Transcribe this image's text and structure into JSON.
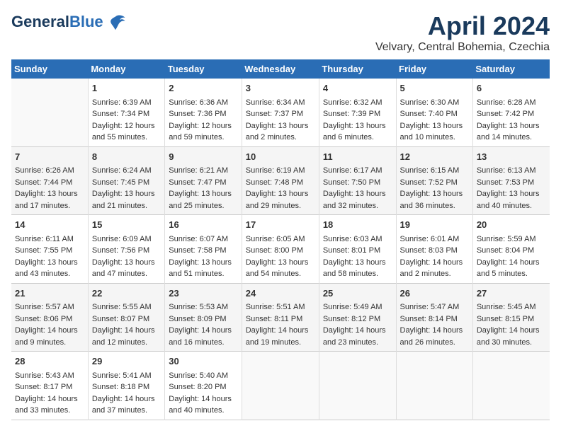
{
  "header": {
    "logo_line1": "General",
    "logo_line2": "Blue",
    "month": "April 2024",
    "location": "Velvary, Central Bohemia, Czechia"
  },
  "weekdays": [
    "Sunday",
    "Monday",
    "Tuesday",
    "Wednesday",
    "Thursday",
    "Friday",
    "Saturday"
  ],
  "weeks": [
    [
      {
        "day": "",
        "info": ""
      },
      {
        "day": "1",
        "info": "Sunrise: 6:39 AM\nSunset: 7:34 PM\nDaylight: 12 hours\nand 55 minutes."
      },
      {
        "day": "2",
        "info": "Sunrise: 6:36 AM\nSunset: 7:36 PM\nDaylight: 12 hours\nand 59 minutes."
      },
      {
        "day": "3",
        "info": "Sunrise: 6:34 AM\nSunset: 7:37 PM\nDaylight: 13 hours\nand 2 minutes."
      },
      {
        "day": "4",
        "info": "Sunrise: 6:32 AM\nSunset: 7:39 PM\nDaylight: 13 hours\nand 6 minutes."
      },
      {
        "day": "5",
        "info": "Sunrise: 6:30 AM\nSunset: 7:40 PM\nDaylight: 13 hours\nand 10 minutes."
      },
      {
        "day": "6",
        "info": "Sunrise: 6:28 AM\nSunset: 7:42 PM\nDaylight: 13 hours\nand 14 minutes."
      }
    ],
    [
      {
        "day": "7",
        "info": "Sunrise: 6:26 AM\nSunset: 7:44 PM\nDaylight: 13 hours\nand 17 minutes."
      },
      {
        "day": "8",
        "info": "Sunrise: 6:24 AM\nSunset: 7:45 PM\nDaylight: 13 hours\nand 21 minutes."
      },
      {
        "day": "9",
        "info": "Sunrise: 6:21 AM\nSunset: 7:47 PM\nDaylight: 13 hours\nand 25 minutes."
      },
      {
        "day": "10",
        "info": "Sunrise: 6:19 AM\nSunset: 7:48 PM\nDaylight: 13 hours\nand 29 minutes."
      },
      {
        "day": "11",
        "info": "Sunrise: 6:17 AM\nSunset: 7:50 PM\nDaylight: 13 hours\nand 32 minutes."
      },
      {
        "day": "12",
        "info": "Sunrise: 6:15 AM\nSunset: 7:52 PM\nDaylight: 13 hours\nand 36 minutes."
      },
      {
        "day": "13",
        "info": "Sunrise: 6:13 AM\nSunset: 7:53 PM\nDaylight: 13 hours\nand 40 minutes."
      }
    ],
    [
      {
        "day": "14",
        "info": "Sunrise: 6:11 AM\nSunset: 7:55 PM\nDaylight: 13 hours\nand 43 minutes."
      },
      {
        "day": "15",
        "info": "Sunrise: 6:09 AM\nSunset: 7:56 PM\nDaylight: 13 hours\nand 47 minutes."
      },
      {
        "day": "16",
        "info": "Sunrise: 6:07 AM\nSunset: 7:58 PM\nDaylight: 13 hours\nand 51 minutes."
      },
      {
        "day": "17",
        "info": "Sunrise: 6:05 AM\nSunset: 8:00 PM\nDaylight: 13 hours\nand 54 minutes."
      },
      {
        "day": "18",
        "info": "Sunrise: 6:03 AM\nSunset: 8:01 PM\nDaylight: 13 hours\nand 58 minutes."
      },
      {
        "day": "19",
        "info": "Sunrise: 6:01 AM\nSunset: 8:03 PM\nDaylight: 14 hours\nand 2 minutes."
      },
      {
        "day": "20",
        "info": "Sunrise: 5:59 AM\nSunset: 8:04 PM\nDaylight: 14 hours\nand 5 minutes."
      }
    ],
    [
      {
        "day": "21",
        "info": "Sunrise: 5:57 AM\nSunset: 8:06 PM\nDaylight: 14 hours\nand 9 minutes."
      },
      {
        "day": "22",
        "info": "Sunrise: 5:55 AM\nSunset: 8:07 PM\nDaylight: 14 hours\nand 12 minutes."
      },
      {
        "day": "23",
        "info": "Sunrise: 5:53 AM\nSunset: 8:09 PM\nDaylight: 14 hours\nand 16 minutes."
      },
      {
        "day": "24",
        "info": "Sunrise: 5:51 AM\nSunset: 8:11 PM\nDaylight: 14 hours\nand 19 minutes."
      },
      {
        "day": "25",
        "info": "Sunrise: 5:49 AM\nSunset: 8:12 PM\nDaylight: 14 hours\nand 23 minutes."
      },
      {
        "day": "26",
        "info": "Sunrise: 5:47 AM\nSunset: 8:14 PM\nDaylight: 14 hours\nand 26 minutes."
      },
      {
        "day": "27",
        "info": "Sunrise: 5:45 AM\nSunset: 8:15 PM\nDaylight: 14 hours\nand 30 minutes."
      }
    ],
    [
      {
        "day": "28",
        "info": "Sunrise: 5:43 AM\nSunset: 8:17 PM\nDaylight: 14 hours\nand 33 minutes."
      },
      {
        "day": "29",
        "info": "Sunrise: 5:41 AM\nSunset: 8:18 PM\nDaylight: 14 hours\nand 37 minutes."
      },
      {
        "day": "30",
        "info": "Sunrise: 5:40 AM\nSunset: 8:20 PM\nDaylight: 14 hours\nand 40 minutes."
      },
      {
        "day": "",
        "info": ""
      },
      {
        "day": "",
        "info": ""
      },
      {
        "day": "",
        "info": ""
      },
      {
        "day": "",
        "info": ""
      }
    ]
  ]
}
